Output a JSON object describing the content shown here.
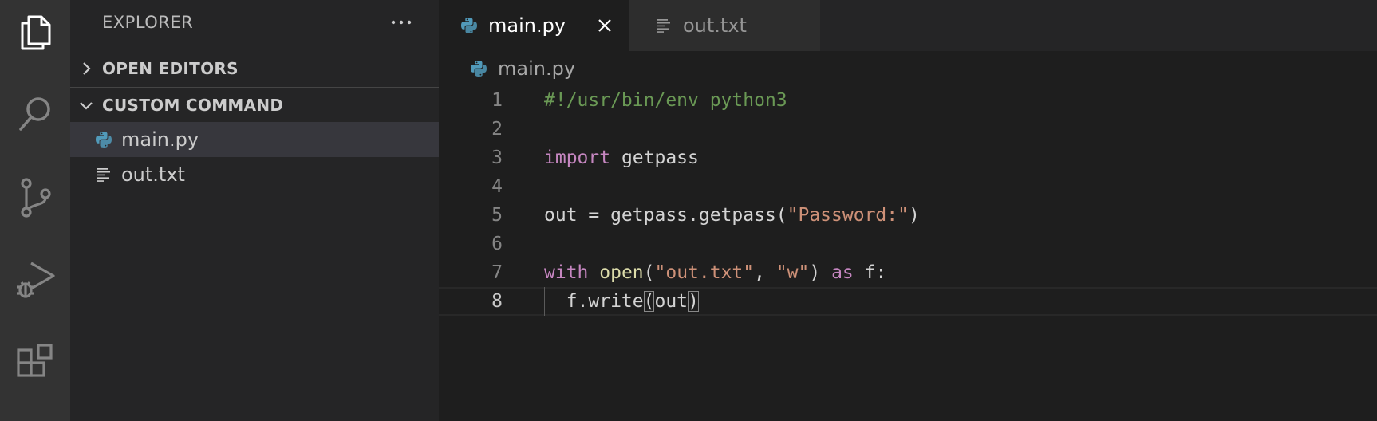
{
  "activity_bar": {
    "items": [
      {
        "icon": "files-icon",
        "active": true
      },
      {
        "icon": "search-icon",
        "active": false
      },
      {
        "icon": "source-control-icon",
        "active": false
      },
      {
        "icon": "run-debug-icon",
        "active": false
      },
      {
        "icon": "extensions-icon",
        "active": false
      }
    ]
  },
  "sidebar": {
    "title": "EXPLORER",
    "more_label": "···",
    "sections": [
      {
        "label": "OPEN EDITORS",
        "expanded": false
      },
      {
        "label": "CUSTOM COMMAND",
        "expanded": true
      }
    ],
    "files": [
      {
        "name": "main.py",
        "icon": "python-file-icon",
        "selected": true
      },
      {
        "name": "out.txt",
        "icon": "text-file-icon",
        "selected": false
      }
    ]
  },
  "tabs": [
    {
      "label": "main.py",
      "icon": "python-file-icon",
      "active": true
    },
    {
      "label": "out.txt",
      "icon": "text-file-icon",
      "active": false
    }
  ],
  "breadcrumb": {
    "file": "main.py"
  },
  "editor": {
    "current_line": 8,
    "lines": [
      {
        "n": "1",
        "tokens": [
          {
            "t": "#!/usr/bin/env python3",
            "c": "comment"
          }
        ]
      },
      {
        "n": "2",
        "tokens": []
      },
      {
        "n": "3",
        "tokens": [
          {
            "t": "import",
            "c": "keyword"
          },
          {
            "t": " getpass",
            "c": "plain"
          }
        ]
      },
      {
        "n": "4",
        "tokens": []
      },
      {
        "n": "5",
        "tokens": [
          {
            "t": "out = getpass.getpass(",
            "c": "plain"
          },
          {
            "t": "\"Password:\"",
            "c": "string"
          },
          {
            "t": ")",
            "c": "plain"
          }
        ]
      },
      {
        "n": "6",
        "tokens": []
      },
      {
        "n": "7",
        "tokens": [
          {
            "t": "with",
            "c": "keyword"
          },
          {
            "t": " ",
            "c": "plain"
          },
          {
            "t": "open",
            "c": "func"
          },
          {
            "t": "(",
            "c": "plain"
          },
          {
            "t": "\"out.txt\"",
            "c": "string"
          },
          {
            "t": ", ",
            "c": "plain"
          },
          {
            "t": "\"w\"",
            "c": "string"
          },
          {
            "t": ") ",
            "c": "plain"
          },
          {
            "t": "as",
            "c": "keyword"
          },
          {
            "t": " f:",
            "c": "plain"
          }
        ]
      },
      {
        "n": "8",
        "tokens": [
          {
            "t": "  f.write",
            "c": "plain"
          },
          {
            "t": "(",
            "c": "bracket-match"
          },
          {
            "t": "out",
            "c": "plain"
          },
          {
            "t": ")",
            "c": "bracket-match"
          }
        ]
      }
    ]
  },
  "colors": {
    "activity_bar_bg": "#333333",
    "sidebar_bg": "#252526",
    "editor_bg": "#1e1e1e",
    "selected_item_bg": "#37373d",
    "python_icon": "#519aba",
    "comment": "#6a9955",
    "keyword": "#c586c0",
    "function": "#dcdcaa",
    "string": "#ce9178"
  }
}
